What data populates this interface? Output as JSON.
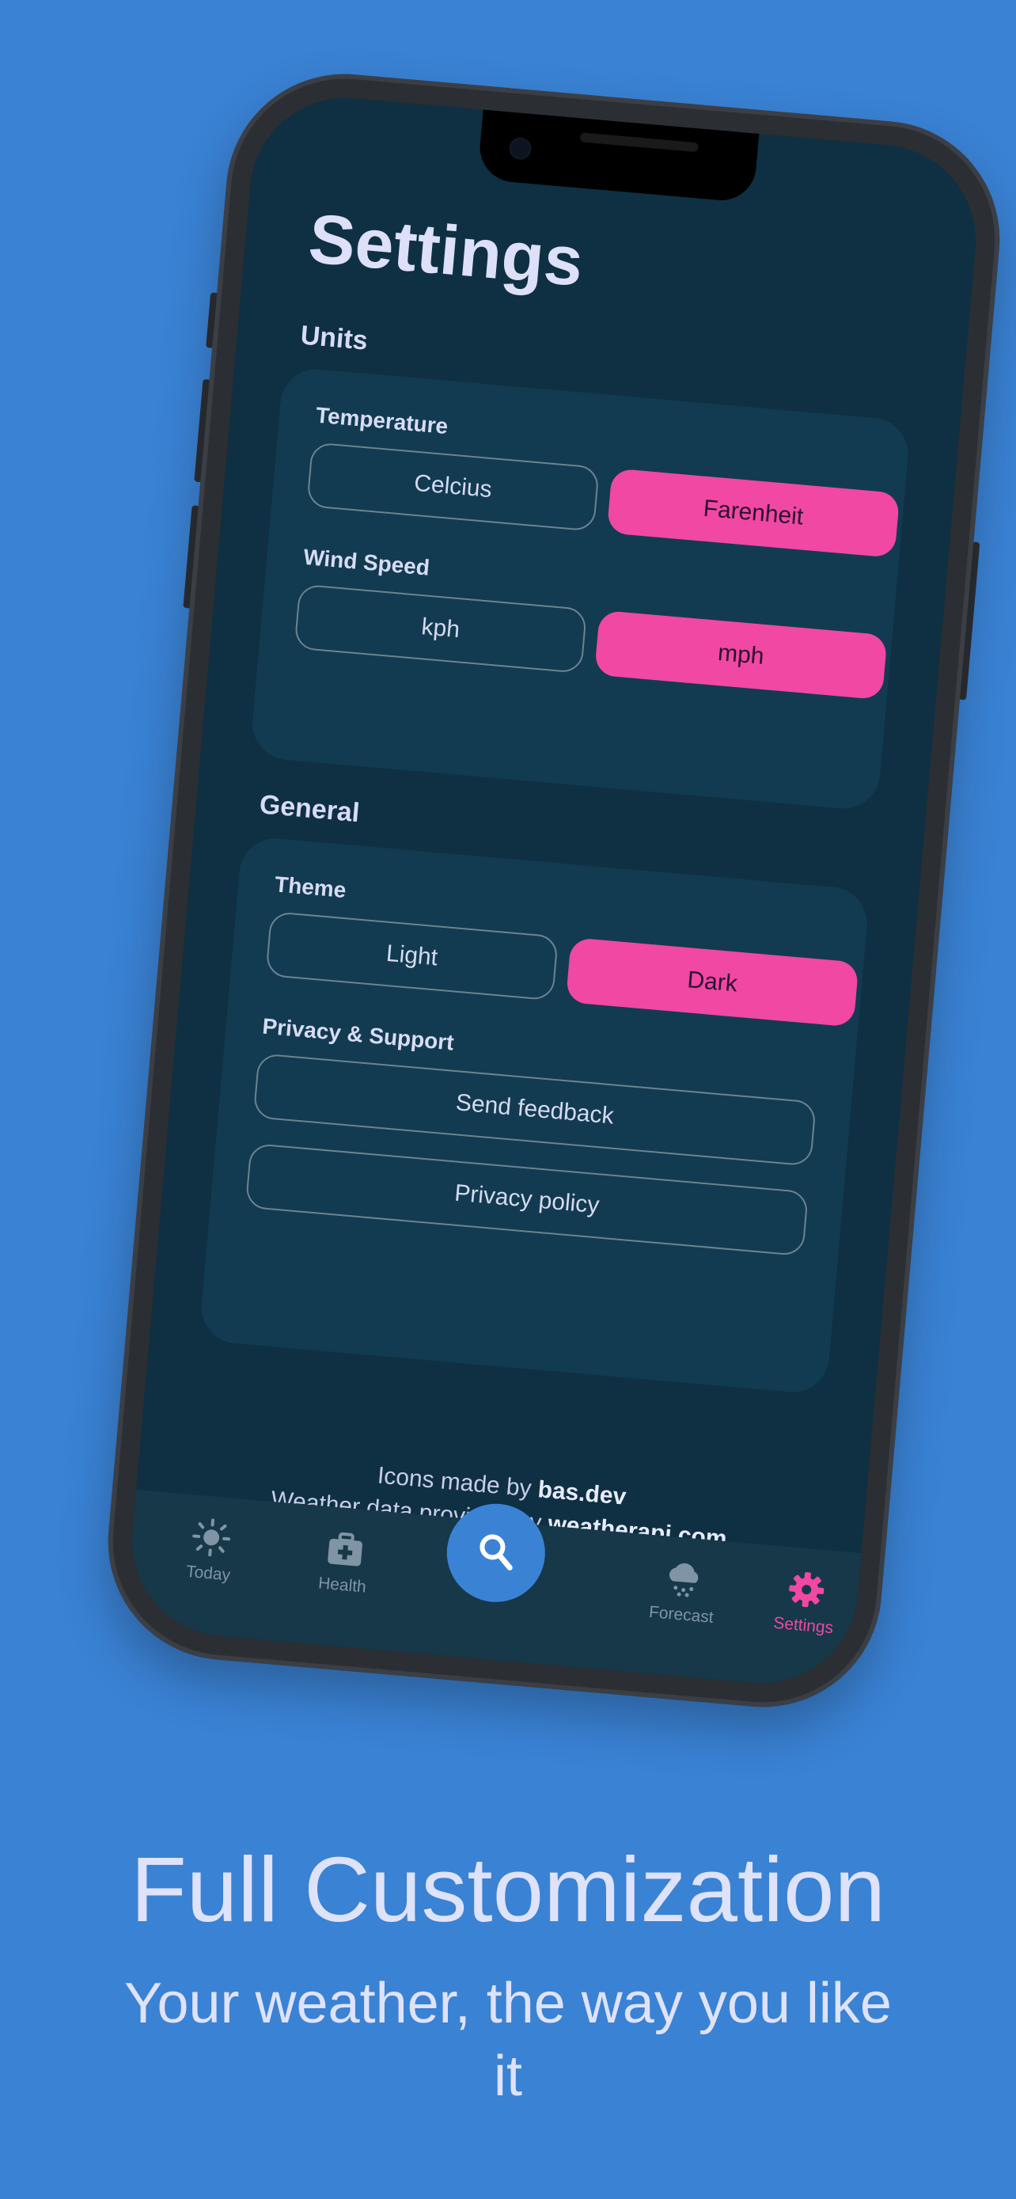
{
  "settings": {
    "title": "Settings",
    "units": {
      "heading": "Units",
      "temperature": {
        "label": "Temperature",
        "options": [
          "Celcius",
          "Farenheit"
        ],
        "selected": "Farenheit"
      },
      "wind_speed": {
        "label": "Wind Speed",
        "options": [
          "kph",
          "mph"
        ],
        "selected": "mph"
      }
    },
    "general": {
      "heading": "General",
      "theme": {
        "label": "Theme",
        "options": [
          "Light",
          "Dark"
        ],
        "selected": "Dark"
      },
      "privacy_support": {
        "label": "Privacy & Support",
        "send_feedback": "Send feedback",
        "privacy_policy": "Privacy policy"
      }
    }
  },
  "credits": {
    "icons_prefix": "Icons made by",
    "icons_author": "bas.dev",
    "data_prefix": "Weather data provided by",
    "data_provider": "weatherapi.com"
  },
  "nav": {
    "items": [
      {
        "label": "Today",
        "icon": "sun-icon"
      },
      {
        "label": "Health",
        "icon": "medical-kit-icon"
      },
      {
        "label": "Forecast",
        "icon": "cloud-snow-icon"
      },
      {
        "label": "Settings",
        "icon": "gear-icon",
        "active": true
      }
    ],
    "search_icon": "search-icon"
  },
  "promo": {
    "headline": "Full Customization",
    "subline": "Your weather, the way you like it"
  },
  "colors": {
    "background": "#3a82d4",
    "screen": "#0e3042",
    "card": "#123b51",
    "accent_pink": "#f048a3",
    "text_light": "#dde0f8"
  }
}
